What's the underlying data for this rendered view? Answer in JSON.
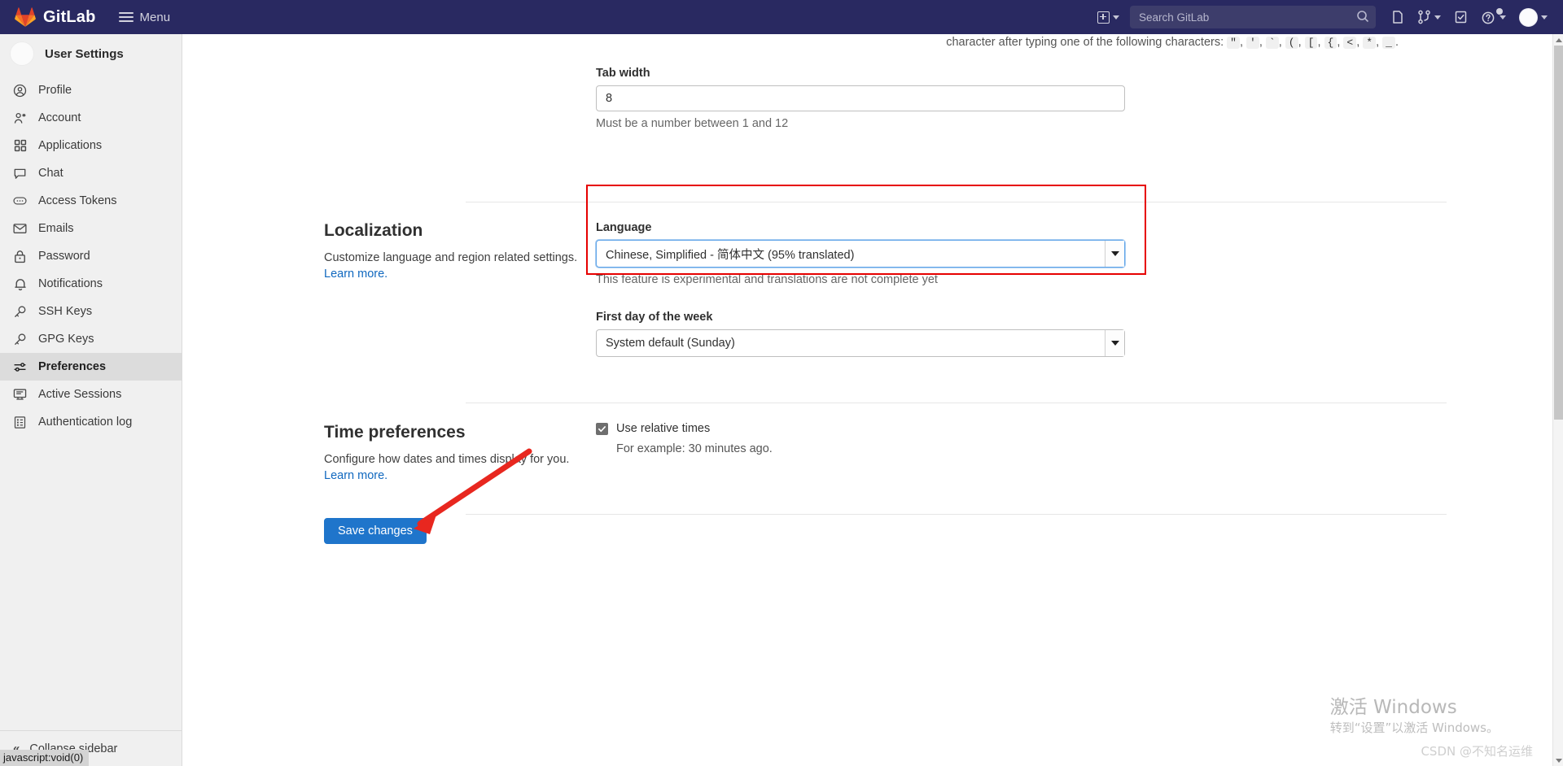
{
  "navbar": {
    "brand": "GitLab",
    "menu_label": "Menu",
    "search_placeholder": "Search GitLab",
    "icons": {
      "create_new": "plus-square-icon",
      "create_new_caret": "chevron-down-icon",
      "search": "search-icon",
      "issues": "issues-icon",
      "merge_requests": "merge-request-icon",
      "todos": "todo-checkbox-icon",
      "help": "question-circle-icon",
      "user_avatar": "avatar-icon"
    }
  },
  "sidebar": {
    "title": "User Settings",
    "items": [
      {
        "label": "Profile",
        "icon": "user-circle-icon",
        "active": false
      },
      {
        "label": "Account",
        "icon": "account-icon",
        "active": false
      },
      {
        "label": "Applications",
        "icon": "applications-grid-icon",
        "active": false
      },
      {
        "label": "Chat",
        "icon": "chat-bubble-icon",
        "active": false
      },
      {
        "label": "Access Tokens",
        "icon": "token-icon",
        "active": false
      },
      {
        "label": "Emails",
        "icon": "envelope-icon",
        "active": false
      },
      {
        "label": "Password",
        "icon": "lock-icon",
        "active": false
      },
      {
        "label": "Notifications",
        "icon": "bell-icon",
        "active": false
      },
      {
        "label": "SSH Keys",
        "icon": "key-icon",
        "active": false
      },
      {
        "label": "GPG Keys",
        "icon": "key-icon",
        "active": false
      },
      {
        "label": "Preferences",
        "icon": "preferences-sliders-icon",
        "active": true
      },
      {
        "label": "Active Sessions",
        "icon": "monitor-icon",
        "active": false
      },
      {
        "label": "Authentication log",
        "icon": "log-list-icon",
        "active": false
      }
    ],
    "collapse_label": "Collapse sidebar",
    "collapse_icon": "double-chevron-left-icon"
  },
  "status_bar": {
    "url": "javascript:void(0)"
  },
  "main": {
    "behavior_tail": {
      "text_before": "character after typing one of the following characters:",
      "keys": [
        "\"",
        "'",
        "`",
        "(",
        "[",
        "{",
        "<",
        "*",
        "_"
      ],
      "separator": ","
    },
    "tab_width": {
      "label": "Tab width",
      "value": "8",
      "help": "Must be a number between 1 and 12"
    },
    "localization": {
      "title": "Localization",
      "description": "Customize language and region related settings.",
      "learn_more": "Learn more.",
      "language": {
        "label": "Language",
        "value": "Chinese, Simplified - 简体中文 (95% translated)",
        "help": "This feature is experimental and translations are not complete yet"
      },
      "first_day": {
        "label": "First day of the week",
        "value": "System default (Sunday)"
      }
    },
    "time_preferences": {
      "title": "Time preferences",
      "description": "Configure how dates and times display for you.",
      "learn_more": "Learn more.",
      "relative_times": {
        "label": "Use relative times",
        "checked": true,
        "example": "For example: 30 minutes ago."
      }
    },
    "save_button": "Save changes"
  },
  "watermark": {
    "line1": "激活 Windows",
    "line2": "转到“设置”以激活 Windows。"
  },
  "credit": "CSDN @不知名运维",
  "colors": {
    "navbar_bg": "#292961",
    "accent_blue": "#1f75cb",
    "link_blue": "#1068bf",
    "annotation_red": "#e60000",
    "sidebar_bg": "#f0f0f0",
    "sidebar_active": "#dcdcdc"
  }
}
